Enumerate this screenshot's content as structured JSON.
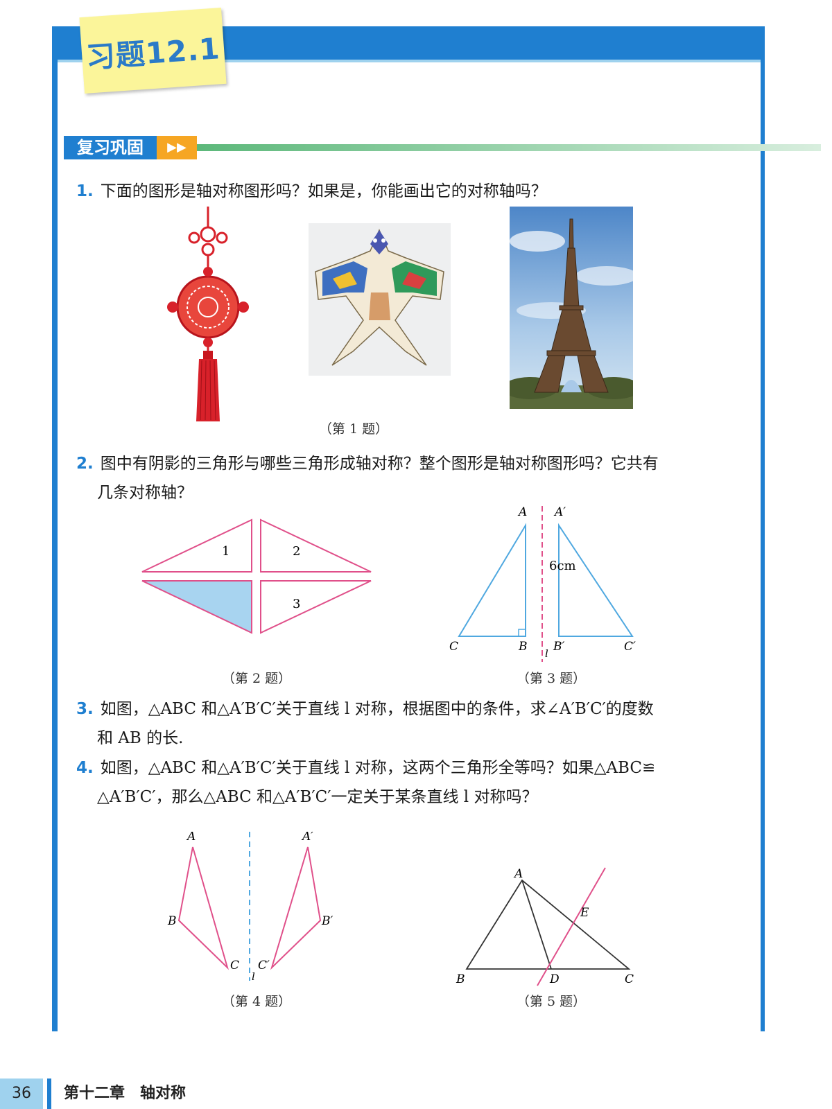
{
  "header": {
    "exercise_label": "习题12.1"
  },
  "section": {
    "title": "复习巩固",
    "arrows": "▶▶"
  },
  "questions": [
    {
      "num": "1.",
      "lines": [
        "下面的图形是轴对称图形吗？如果是，你能画出它的对称轴吗？"
      ]
    },
    {
      "num": "2.",
      "lines": [
        "图中有阴影的三角形与哪些三角形成轴对称？整个图形是轴对称图形吗？它共有",
        "几条对称轴？"
      ]
    },
    {
      "num": "3.",
      "lines": [
        "如图，△ABC 和△A′B′C′关于直线 l 对称，根据图中的条件，求∠A′B′C′的度数",
        "和 AB 的长."
      ]
    },
    {
      "num": "4.",
      "lines": [
        "如图，△ABC 和△A′B′C′关于直线 l 对称，这两个三角形全等吗？如果△ABC≌",
        "△A′B′C′，那么△ABC 和△A′B′C′一定关于某条直线 l 对称吗？"
      ]
    }
  ],
  "captions": {
    "fig1": "（第 1 题）",
    "fig2": "（第 2 题）",
    "fig3": "（第 3 题）",
    "fig4": "（第 4 题）",
    "fig5": "（第 5 题）"
  },
  "fig2_labels": [
    "1",
    "2",
    "3"
  ],
  "fig3_labels": {
    "A": "A",
    "A2": "A′",
    "B": "B",
    "B2": "B′",
    "C": "C",
    "C2": "C′",
    "l": "l",
    "len": "6cm"
  },
  "fig4_labels": {
    "A": "A",
    "A2": "A′",
    "B": "B",
    "B2": "B′",
    "C": "C",
    "C2": "C′",
    "l": "l"
  },
  "fig5_labels": {
    "A": "A",
    "B": "B",
    "C": "C",
    "D": "D",
    "E": "E"
  },
  "footer": {
    "page_number": "36",
    "chapter": "第十二章　轴对称"
  },
  "colors": {
    "frame_blue": "#1f7fd0",
    "triangle_pink": "#e0508a",
    "triangle_blue": "#4fa8e0",
    "shade": "#a8d4f0"
  }
}
